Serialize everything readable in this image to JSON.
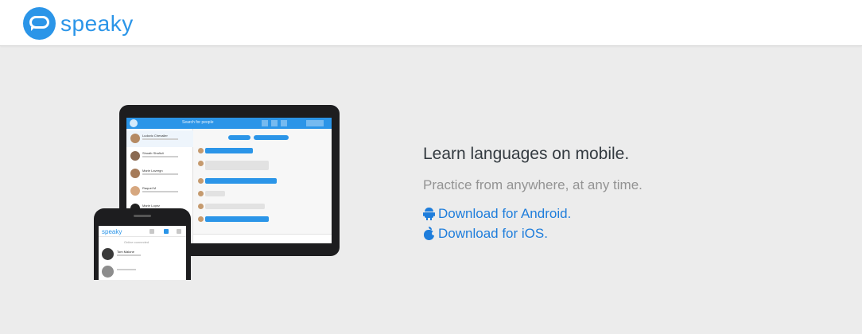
{
  "header": {
    "brand": "speaky"
  },
  "promo": {
    "title": "Learn languages on mobile.",
    "subtitle": "Practice from anywhere, at any time.",
    "android_label": "Download for Android.",
    "ios_label": "Download for iOS."
  },
  "mockup": {
    "tablet_search": "Search for people",
    "tablet_contacts": [
      "Ludovic Chevalier",
      "Shoaib Shafiuli",
      "Marie Lavergn",
      "Raquel M",
      "Marie Lopez"
    ],
    "phone_brand": "speaky",
    "phone_subtitle": "Online connected",
    "phone_contact": "Tom Malone"
  },
  "colors": {
    "accent": "#2b95e8",
    "link": "#1e7ddb",
    "background": "#ececec"
  },
  "icons": {
    "logo": "speech-bubble-icon",
    "android": "android-icon",
    "ios": "apple-icon"
  }
}
